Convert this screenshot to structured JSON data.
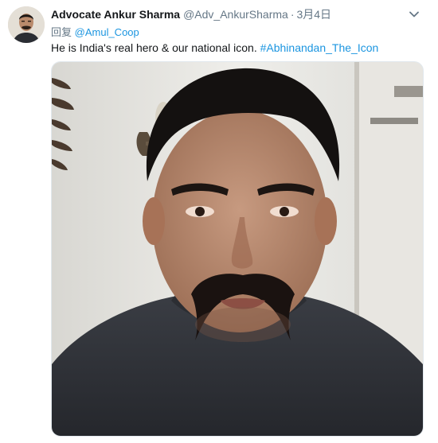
{
  "tweet": {
    "display_name": "Advocate Ankur Sharma",
    "handle": "@Adv_AnkurSharma",
    "separator": "·",
    "timestamp": "3月4日",
    "reply_prefix": "回复",
    "reply_mention": "@Amul_Coop",
    "text": "He is India's real hero & our national icon.",
    "hashtag": "#Abhinandan_The_Icon",
    "caret_icon": "chevron-down-icon"
  },
  "colors": {
    "link": "#1b95e0",
    "secondary_text": "#657786",
    "primary_text": "#14171a"
  }
}
